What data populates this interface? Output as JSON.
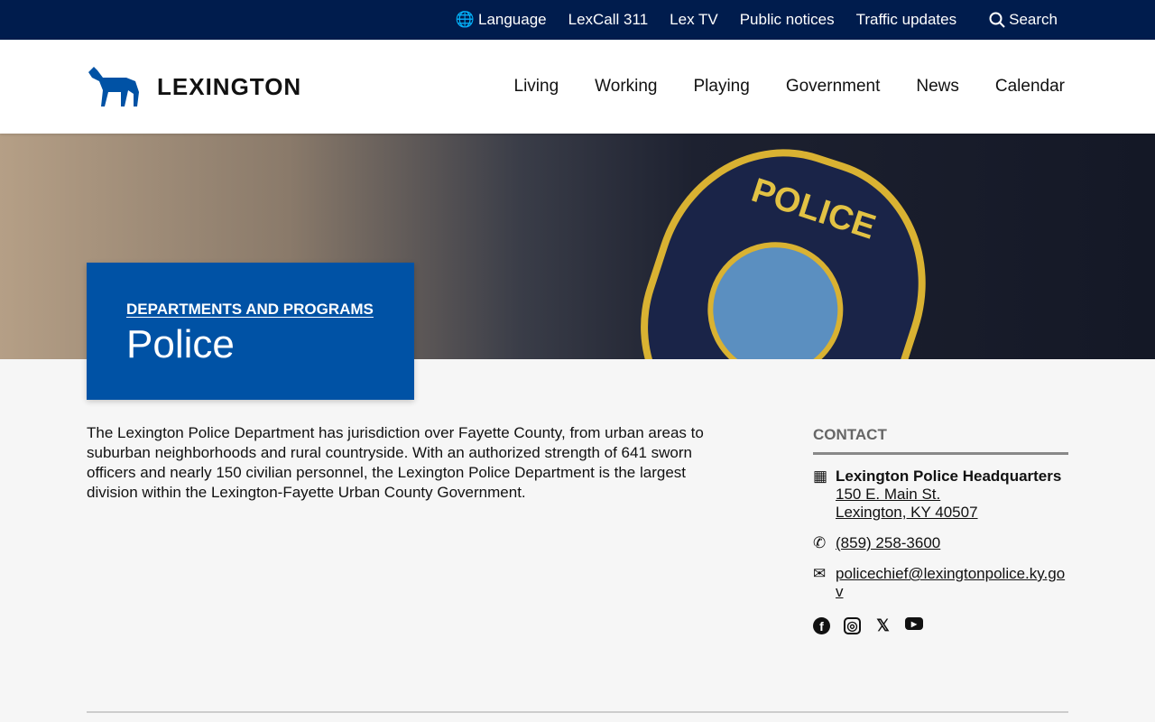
{
  "utility_nav": {
    "language": "Language",
    "lexcall": "LexCall 311",
    "lextv": "Lex TV",
    "notices": "Public notices",
    "traffic": "Traffic updates",
    "search": "Search"
  },
  "header": {
    "logo": "LEXINGTON",
    "nav": [
      "Living",
      "Working",
      "Playing",
      "Government",
      "News",
      "Calendar"
    ]
  },
  "hero": {
    "kicker": "DEPARTMENTS AND PROGRAMS",
    "title": "Police"
  },
  "body": "The Lexington Police Department has jurisdiction over Fayette County, from urban areas to suburban neighborhoods and rural countryside. With an authorized strength of 641 sworn officers and nearly 150 civilian personnel, the Lexington Police Department is the largest division within the Lexington-Fayette Urban County Government.",
  "contact": {
    "heading": "CONTACT",
    "name": "Lexington Police Headquarters",
    "address1": "150 E. Main St.",
    "address2": "Lexington, KY 40507",
    "phone": "(859) 258-3600",
    "email": "policechief@lexingtonpolice.ky.gov"
  }
}
